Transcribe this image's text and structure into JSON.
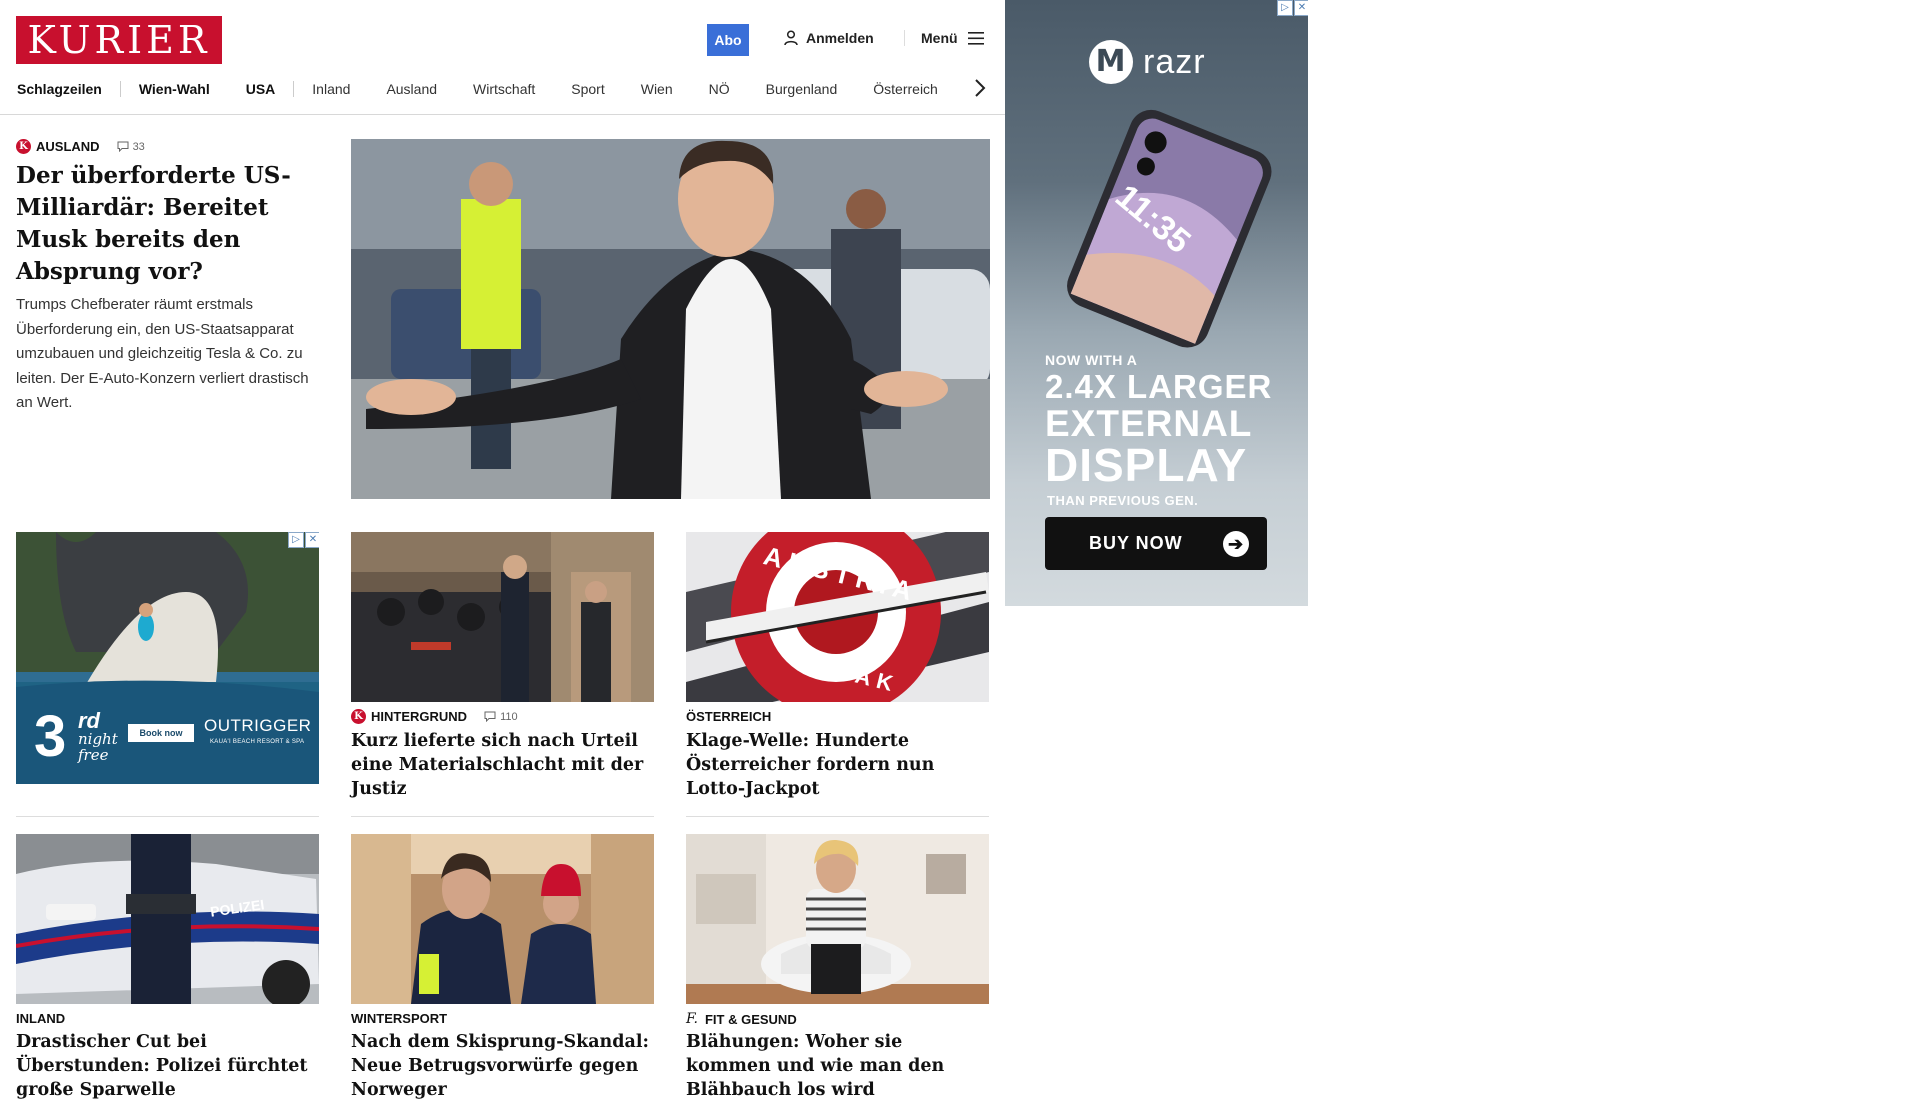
{
  "header": {
    "logo": "KURIER",
    "abo_label": "Abo",
    "login_label": "Anmelden",
    "menu_label": "Menü"
  },
  "nav": {
    "items": [
      "Schlagzeilen",
      "Wien-Wahl",
      "USA",
      "Inland",
      "Ausland",
      "Wirtschaft",
      "Sport",
      "Wien",
      "NÖ",
      "Burgenland",
      "Österreich"
    ]
  },
  "main_story": {
    "kicker": "AUSLAND",
    "comments": "33",
    "title": "Der überforderte US-Milliardär: Bereitet Musk bereits den Absprung vor?",
    "teaser": "Trumps Chefberater räumt erstmals Überforderung ein, den US-Staatsapparat umzubauen und gleichzeitig Tesla & Co. zu leiten. Der E-Auto-Konzern verliert drastisch an Wert."
  },
  "cards": [
    {
      "kicker": "HINTERGRUND",
      "comments": "110",
      "title": "Kurz lieferte sich nach Urteil eine Materialschlacht mit der Justiz"
    },
    {
      "kicker": "ÖSTERREICH",
      "title": "Klage-Welle: Hunderte Österreicher fordern nun Lotto-Jackpot"
    },
    {
      "kicker": "INLAND",
      "title": "Drastischer Cut bei Überstunden: Polizei fürchtet große Sparwelle"
    },
    {
      "kicker": "WINTERSPORT",
      "title": "Nach dem Skisprung-Skandal: Neue Betrugsvorwürfe gegen Norweger"
    },
    {
      "kicker": "FIT & GESUND",
      "title": "Blähungen: Woher sie kommen und wie man den Blähbauch los wird"
    }
  ],
  "sign_texts": {
    "austria_tabak_top": "AUSTRIA",
    "austria_tabak_bottom": "TABAK",
    "polizei": "POLIZEI"
  },
  "left_ad": {
    "offer_number": "3",
    "offer_suffix": "rd",
    "offer_line1": "night",
    "offer_line2": "free",
    "button": "Book now",
    "brand": "OUTRIGGER",
    "brand_sub": "KAUA'I BEACH RESORT & SPA"
  },
  "right_ad": {
    "brand": "razr",
    "phone_time": "11:35",
    "line1": "NOW WITH A",
    "line2": "2.4X LARGER",
    "line3": "EXTERNAL",
    "line4": "DISPLAY",
    "line5": "THAN PREVIOUS GEN.",
    "button": "BUY NOW"
  },
  "colors": {
    "brand_red": "#c8102e",
    "abo_blue": "#3a6fd8"
  }
}
